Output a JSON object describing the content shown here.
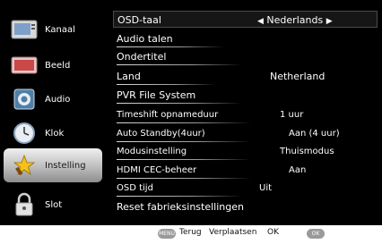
{
  "sidebar": {
    "items": [
      {
        "label": "Kanaal",
        "icon": "tv-channel-icon"
      },
      {
        "label": "Beeld",
        "icon": "picture-icon"
      },
      {
        "label": "Audio",
        "icon": "speaker-icon"
      },
      {
        "label": "Klok",
        "icon": "clock-icon"
      },
      {
        "label": "Instelling",
        "icon": "star-settings-icon",
        "selected": true
      },
      {
        "label": "Slot",
        "icon": "padlock-icon"
      }
    ]
  },
  "menu": {
    "rows": [
      {
        "label": "OSD-taal",
        "value": "Nederlands",
        "selected": true
      },
      {
        "label": "Audio talen",
        "value": ""
      },
      {
        "label": "Ondertitel",
        "value": ""
      },
      {
        "label": "Land",
        "value": "Netherland"
      },
      {
        "label": "PVR File System",
        "value": ""
      },
      {
        "label": "Timeshift opnameduur",
        "value": "1 uur"
      },
      {
        "label": "Auto Standby(4uur)",
        "value": "Aan (4 uur)"
      },
      {
        "label": "Modusinstelling",
        "value": "Thuismodus"
      },
      {
        "label": "HDMI CEC-beheer",
        "value": "Aan"
      },
      {
        "label": "OSD tijd",
        "value": "Uit"
      },
      {
        "label": "Reset fabrieksinstellingen",
        "value": ""
      }
    ],
    "left_arrow": "◀",
    "right_arrow": "▶"
  },
  "hints": {
    "menu_key": "MENU",
    "back_text": "Terug",
    "select_text": "Verplaatsen",
    "ok_text": "OK",
    "ok_key": "OK"
  },
  "colors": {
    "background": "#000000",
    "text": "#ffffff",
    "selected_sidebar": "#bdbdbd"
  }
}
